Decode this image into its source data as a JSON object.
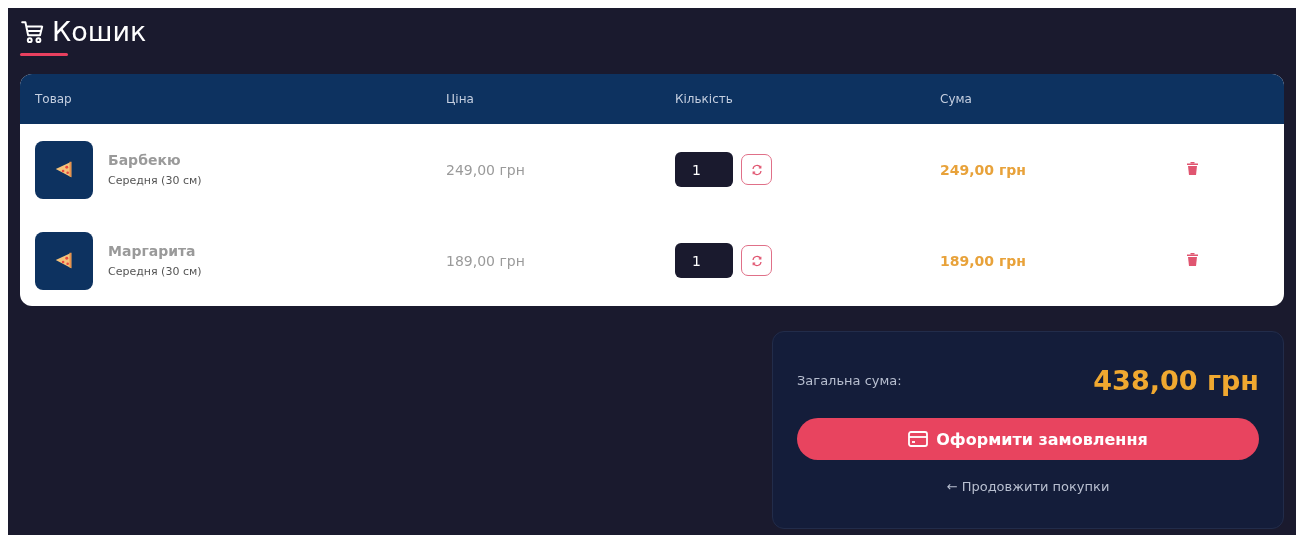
{
  "page": {
    "title": "Кошик"
  },
  "table": {
    "columns": [
      "Товар",
      "Ціна",
      "Кількість",
      "Сума"
    ],
    "rows": [
      {
        "name": "Барбекю",
        "size": "Середня (30 см)",
        "price": "249,00 грн",
        "quantity": "1",
        "sum": "249,00 грн"
      },
      {
        "name": "Маргарита",
        "size": "Середня (30 см)",
        "price": "189,00 грн",
        "quantity": "1",
        "sum": "189,00 грн"
      }
    ]
  },
  "summary": {
    "label": "Загальна сума:",
    "total": "438,00 грн",
    "checkout_button": "Оформити замовлення",
    "continue_link": "← Продовжити покупки"
  }
}
